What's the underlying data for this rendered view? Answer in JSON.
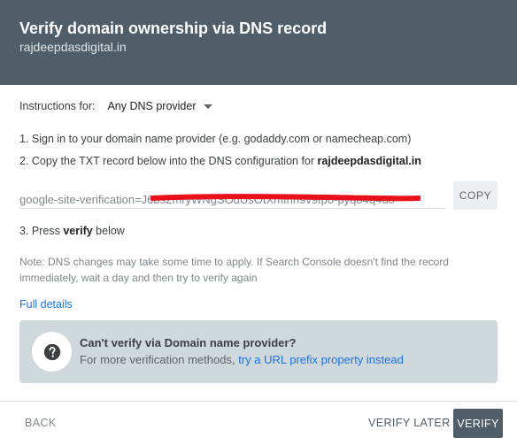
{
  "dialog": {
    "title": "Verify domain ownership via DNS record",
    "domain": "rajdeepdasdigital.in"
  },
  "instructions": {
    "label": "Instructions for:",
    "provider_selected": "Any DNS provider"
  },
  "steps": {
    "step1": "1. Sign in to your domain name provider (e.g. godaddy.com or namecheap.com)",
    "step2_prefix": "2. Copy the TXT record below into the DNS configuration for ",
    "step2_domain": "rajdeepdasdigital.in",
    "step3_prefix": "3. Press ",
    "step3_bold": "verify",
    "step3_suffix": " below"
  },
  "txt_record": {
    "value": "google-site-verification=J6bs2mryWNgSOdUsOtXmInn9v9fp8-pyq84q4u8",
    "copy_label": "COPY",
    "redaction_color": "#e8111b"
  },
  "note": "Note: DNS changes may take some time to apply. If Search Console doesn't find the record immediately, wait a day and then try to verify again",
  "full_details_link": "Full details",
  "info_box": {
    "icon": "help-icon",
    "title": "Can't verify via Domain name provider?",
    "text": "For more verification methods, ",
    "link": "try a URL prefix property instead"
  },
  "footer": {
    "back_label": "BACK",
    "verify_later_label": "VERIFY LATER",
    "verify_label": "VERIFY"
  },
  "colors": {
    "header_bg": "#4f5e68",
    "link": "#1a73e8",
    "info_bg": "#cfd8dc"
  }
}
